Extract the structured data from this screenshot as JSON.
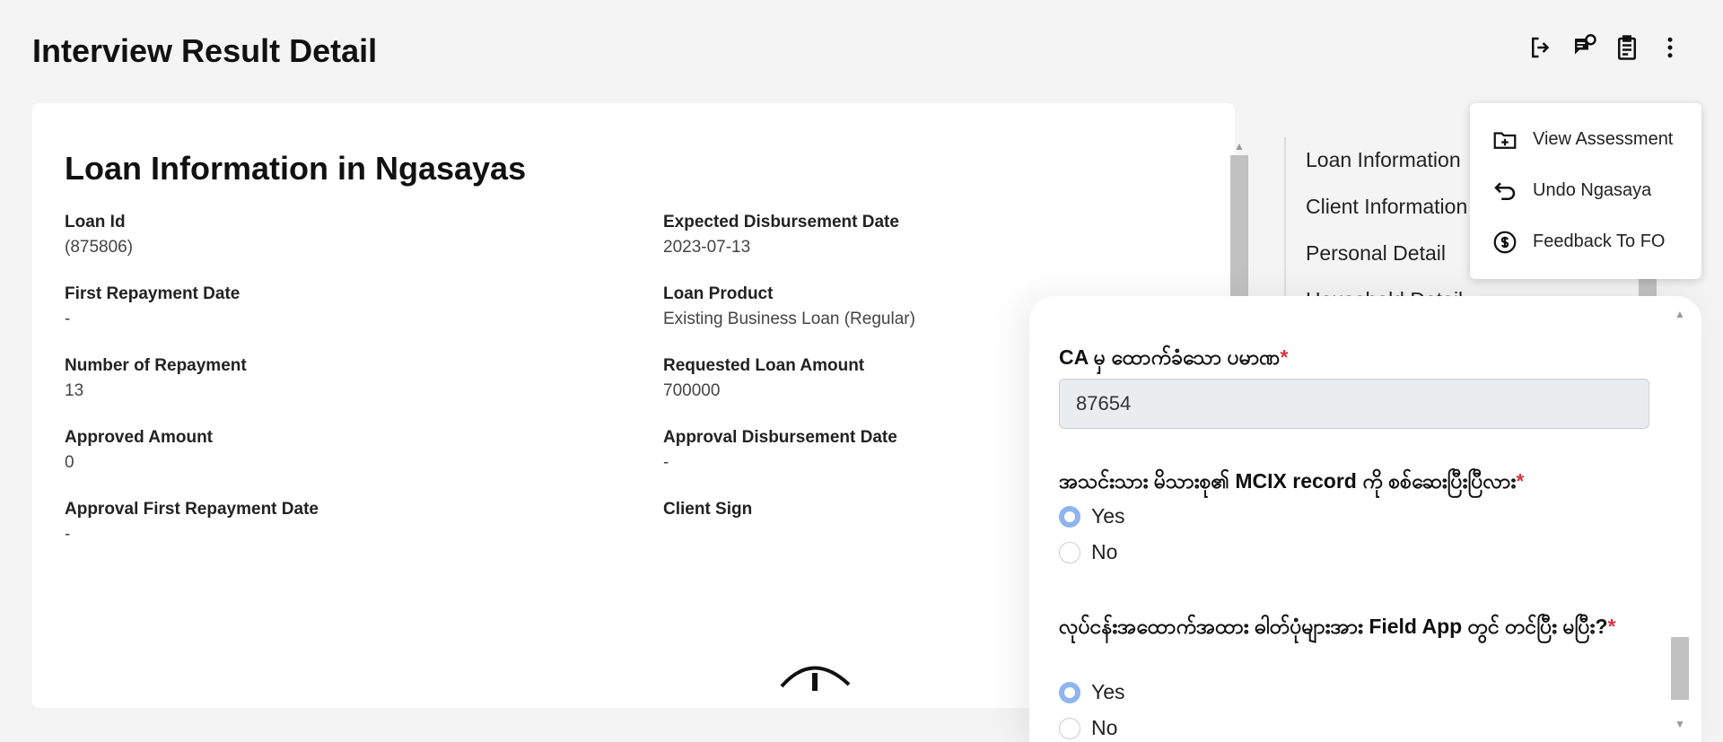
{
  "header": {
    "title": "Interview Result Detail"
  },
  "toolbar": {
    "icons": [
      "logout-icon",
      "feedback-icon",
      "clipboard-icon",
      "more-vert-icon"
    ]
  },
  "loan": {
    "section_title": "Loan Information in Ngasayas",
    "fields": [
      {
        "label": "Loan Id",
        "value": "(875806)"
      },
      {
        "label": "Expected Disbursement Date",
        "value": "2023-07-13"
      },
      {
        "label": "First Repayment Date",
        "value": "-"
      },
      {
        "label": "Loan Product",
        "value": "Existing Business Loan (Regular)"
      },
      {
        "label": "Number of Repayment",
        "value": "13"
      },
      {
        "label": "Requested Loan Amount",
        "value": "700000"
      },
      {
        "label": "Approved Amount",
        "value": "0"
      },
      {
        "label": "Approval Disbursement Date",
        "value": "-"
      },
      {
        "label": "Approval First Repayment Date",
        "value": "-"
      },
      {
        "label": "Client Sign",
        "value": ""
      }
    ]
  },
  "side_nav": {
    "items": [
      "Loan Information",
      "Client Information",
      "Personal Detail",
      "Household Detail"
    ]
  },
  "menu": {
    "items": [
      {
        "label": "View Assessment",
        "icon": "folder-plus-icon"
      },
      {
        "label": "Undo Ngasaya",
        "icon": "undo-icon"
      },
      {
        "label": "Feedback To FO",
        "icon": "currency-exchange-icon"
      }
    ]
  },
  "panel": {
    "q1": {
      "label": "CA မှ ထောက်ခံသော ပမာဏ",
      "required": "*",
      "value": "87654"
    },
    "q2": {
      "label": "အသင်းသား မိသားစု၏ MCIX record ကို စစ်ဆေးပြီးပြီလား",
      "required": "*",
      "options": [
        "Yes",
        "No"
      ],
      "selected": "Yes"
    },
    "q3": {
      "label": "လုပ်ငန်းအထောက်အထား ဓါတ်ပုံများအား Field App တွင် တင်ပြီး မပြီး?",
      "required": "*",
      "options": [
        "Yes",
        "No"
      ],
      "selected": "Yes"
    }
  },
  "colors": {
    "required": "#d9363e",
    "radio_selected": "#8fb4f2",
    "input_bg": "#eaedf0"
  }
}
